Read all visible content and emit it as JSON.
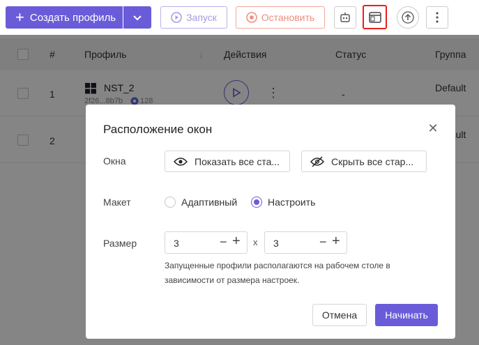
{
  "toolbar": {
    "create_label": "Создать профиль",
    "launch_label": "Запуск",
    "stop_label": "Остановить"
  },
  "table": {
    "columns": [
      "#",
      "Профиль",
      "Действия",
      "Статус",
      "Группа"
    ],
    "rows": [
      {
        "num": "1",
        "name": "NST_2",
        "id": "2f26...8b7b",
        "version": "128",
        "status": "-",
        "group": "Default"
      },
      {
        "num": "2",
        "group": "Default"
      }
    ]
  },
  "modal": {
    "title": "Расположение окон",
    "windows_label": "Окна",
    "show_all": "Показать все ста...",
    "hide_all": "Скрыть все стар...",
    "layout_label": "Макет",
    "layout_options": [
      "Адаптивный",
      "Настроить"
    ],
    "layout_selected": "Настроить",
    "size_label": "Размер",
    "rows_value": "3",
    "cols_value": "3",
    "size_separator": "x",
    "hint": "Запущенные профили располагаются на рабочем столе в зависимости от размера настроек.",
    "cancel_label": "Отмена",
    "start_label": "Начинать"
  },
  "colors": {
    "accent": "#6a5cd9",
    "highlight": "#e8201c",
    "stop": "#ee8d7a"
  }
}
